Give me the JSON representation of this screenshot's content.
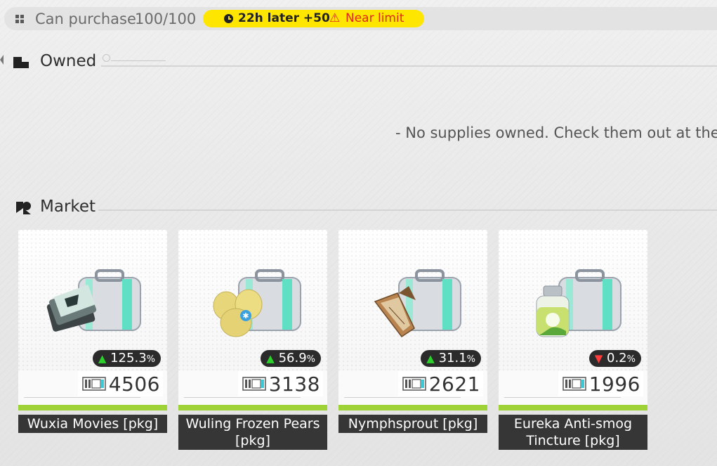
{
  "purchase_bar": {
    "label": "Can purchase",
    "count": "100/100",
    "refill": "22h later +50",
    "warning": "Near limit",
    "accent_color": "#ffe600",
    "warning_color": "#e0271b"
  },
  "owned": {
    "title": "Owned",
    "empty_message": "- No supplies owned. Check them out at the"
  },
  "market": {
    "title": "Market",
    "items": [
      {
        "name": "Wuxia Movies [pkg]",
        "change": "125.3",
        "change_unit": "%",
        "direction": "up",
        "price": "4506",
        "icon": "film-reels-icon"
      },
      {
        "name": "Wuling Frozen Pears [pkg]",
        "change": "56.9",
        "change_unit": "%",
        "direction": "up",
        "price": "3138",
        "icon": "frozen-pears-icon"
      },
      {
        "name": "Nymphsprout [pkg]",
        "change": "31.1",
        "change_unit": "%",
        "direction": "up",
        "price": "2621",
        "icon": "sprout-icon"
      },
      {
        "name": "Eureka Anti-smog Tincture [pkg]",
        "change": "0.2",
        "change_unit": "%",
        "direction": "down",
        "price": "1996",
        "icon": "tincture-bottle-icon"
      }
    ]
  },
  "colors": {
    "up": "#2bd02b",
    "down": "#ff3b3b",
    "card_accent": "#9ed236"
  }
}
